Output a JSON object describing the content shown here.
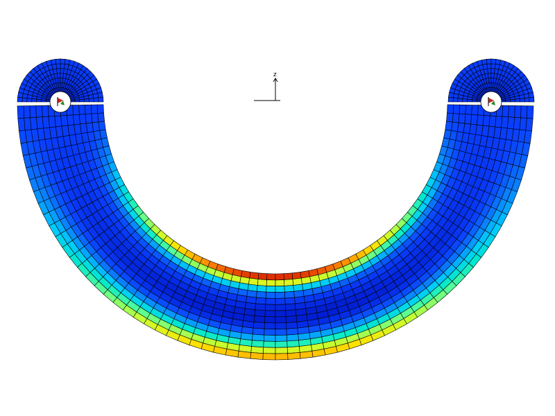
{
  "viewer": {
    "background": "#ffffff",
    "mesh_color": "#000000",
    "triad": {
      "axis_label": "z"
    },
    "colormap": [
      "#001acc",
      "#0a40ff",
      "#0a80ff",
      "#00c8ff",
      "#00e8d0",
      "#60ff90",
      "#c8ff30",
      "#ffe000",
      "#ff9000",
      "#e03000"
    ],
    "icons": [
      "boundary-condition-icon"
    ]
  }
}
